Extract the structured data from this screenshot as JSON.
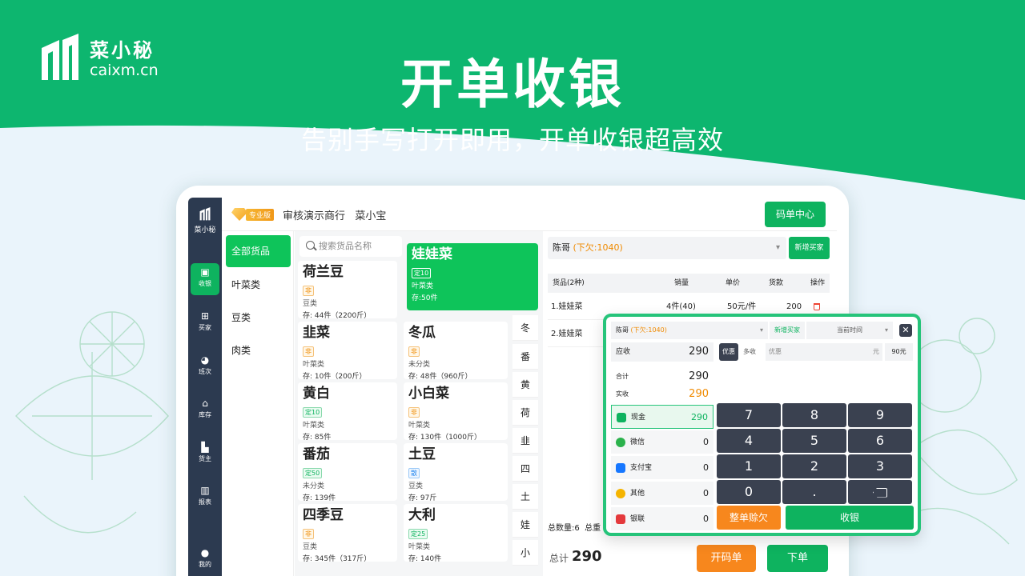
{
  "colors": {
    "brand": "#0eb35f",
    "accent_orange": "#f7871d",
    "nav": "#2c3a50",
    "key": "#3a4150"
  },
  "brand": {
    "name_cn": "菜小秘",
    "domain": "caixm.cn"
  },
  "hero": {
    "title": "开单收银",
    "subtitle": "告别手写打开即用，开单收银超高效"
  },
  "app": {
    "nav": {
      "logo": "菜小秘",
      "items": [
        {
          "label": "收银",
          "icon": "cashier-icon"
        },
        {
          "label": "买家",
          "icon": "basket-icon"
        },
        {
          "label": "班次",
          "icon": "pie-icon"
        },
        {
          "label": "库存",
          "icon": "warehouse-icon"
        },
        {
          "label": "货主",
          "icon": "truck-icon"
        },
        {
          "label": "报表",
          "icon": "report-icon"
        },
        {
          "label": "我的",
          "icon": "user-icon"
        }
      ]
    },
    "topbar": {
      "pro_tag": "专业版",
      "shop_name": "审核演示商行",
      "user": "菜小宝",
      "qr_button": "码单中心"
    },
    "categories": [
      "全部货品",
      "叶菜类",
      "豆类",
      "肉类"
    ],
    "search": {
      "placeholder": "搜索货品名称"
    },
    "goods": [
      {
        "name": "荷兰豆",
        "tag": "非",
        "cat": "豆类",
        "stock": "存: 44件（2200斤）"
      },
      {
        "name": "娃娃菜",
        "tag": "定10",
        "cat": "叶菜类",
        "stock": "存:50件"
      },
      {
        "name": "韭菜",
        "tag": "非",
        "cat": "叶菜类",
        "stock": "存: 10件（200斤）"
      },
      {
        "name": "冬瓜",
        "tag": "非",
        "cat": "未分类",
        "stock": "存: 48件（960斤）"
      },
      {
        "name": "黄白",
        "tag": "定10",
        "cat": "叶菜类",
        "stock": "存: 85件"
      },
      {
        "name": "小白菜",
        "tag": "非",
        "cat": "叶菜类",
        "stock": "存: 130件（1000斤）"
      },
      {
        "name": "番茄",
        "tag": "定50",
        "cat": "未分类",
        "stock": "存: 139件"
      },
      {
        "name": "土豆",
        "tag": "散",
        "cat": "豆类",
        "stock": "存: 97斤"
      },
      {
        "name": "四季豆",
        "tag": "非",
        "cat": "豆类",
        "stock": "存: 345件（317斤）"
      },
      {
        "name": "大利",
        "tag": "定25",
        "cat": "叶菜类",
        "stock": "存: 140件"
      }
    ],
    "index": [
      "冬",
      "番",
      "黄",
      "荷",
      "韭",
      "四",
      "土",
      "娃",
      "小"
    ],
    "order": {
      "buyer": "陈哥",
      "buyer_debt": "(下欠:1040)",
      "new_buyer": "新增买家",
      "headers": {
        "item": "货品(2种)",
        "qty": "销量",
        "price": "单价",
        "amount": "货款",
        "op": "操作"
      },
      "rows": [
        {
          "name": "1.娃娃菜",
          "qty": "4件(40)",
          "price": "50元/件",
          "amount": "200"
        },
        {
          "name": "2.娃娃菜"
        }
      ],
      "summary_qty": "总数量:6",
      "summary_weight": "总重",
      "total_label": "总计",
      "total_value": "290",
      "btn_open": "开码单",
      "btn_submit": "下单"
    },
    "popup": {
      "buyer": "陈哥",
      "buyer_debt": "(下欠:1040)",
      "new_buyer": "新增买家",
      "time": "当前时间",
      "due_label": "应收",
      "due_value": "290",
      "chip_discount": "优惠",
      "chip_extra": "多收",
      "discount_placeholder": "优惠",
      "discount_unit": "元",
      "discount_value": "90元",
      "subtotal_label": "合计",
      "subtotal_value": "290",
      "paid_label": "实收",
      "paid_value": "290",
      "payments": [
        {
          "label": "现金",
          "value": "290"
        },
        {
          "label": "微信",
          "value": "0"
        },
        {
          "label": "支付宝",
          "value": "0"
        },
        {
          "label": "其他",
          "value": "0"
        },
        {
          "label": "银联",
          "value": "0"
        }
      ],
      "keys": [
        "7",
        "8",
        "9",
        "4",
        "5",
        "6",
        "1",
        "2",
        "3",
        "0",
        "."
      ],
      "btn_credit": "整单赊欠",
      "btn_checkout": "收银"
    }
  }
}
